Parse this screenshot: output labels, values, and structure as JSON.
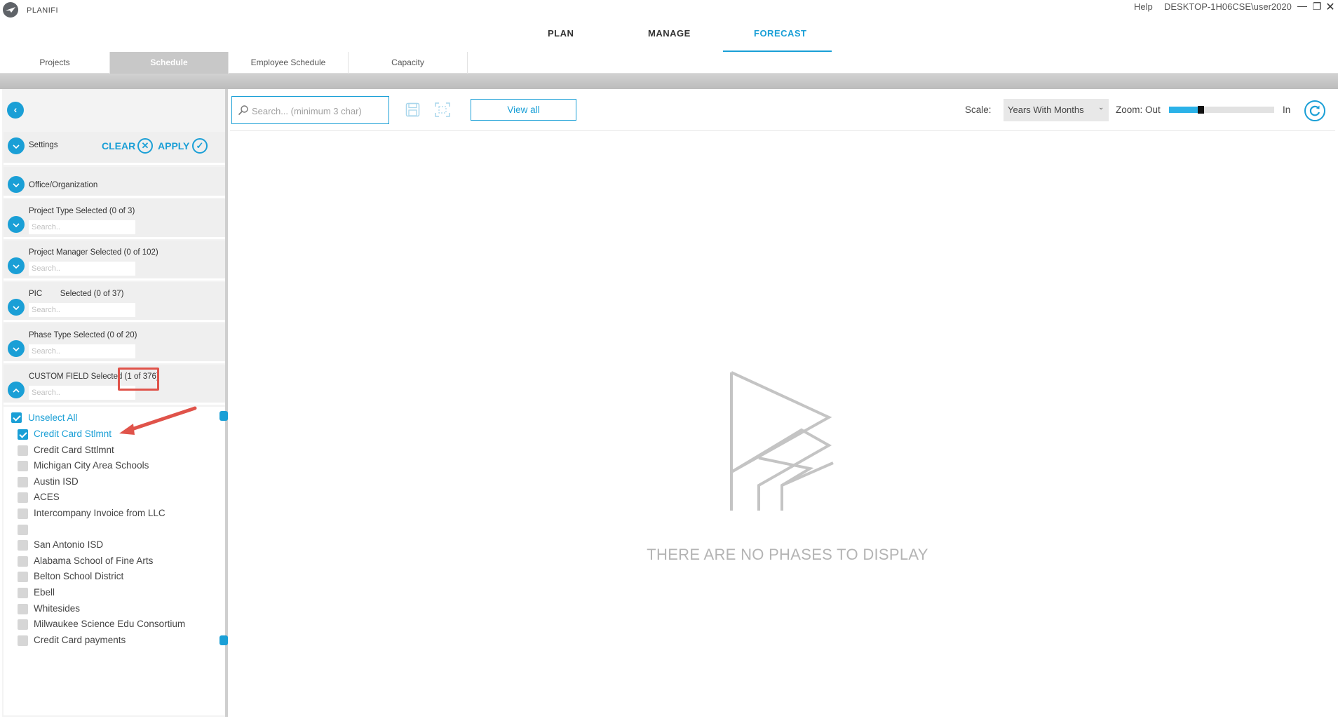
{
  "app": {
    "name": "PLANIFI",
    "help": "Help",
    "user": "DESKTOP-1H06CSE\\user2020"
  },
  "nav": {
    "items": [
      {
        "label": "PLAN"
      },
      {
        "label": "MANAGE"
      },
      {
        "label": "FORECAST",
        "active": true
      }
    ]
  },
  "subtabs": [
    {
      "label": "Projects"
    },
    {
      "label": "Schedule",
      "active": true
    },
    {
      "label": "Employee Schedule"
    },
    {
      "label": "Capacity"
    }
  ],
  "sidebar": {
    "settings_label": "Settings",
    "clear_label": "CLEAR",
    "apply_label": "APPLY",
    "office_label": "Office/Organization",
    "filters": [
      {
        "label": "Project Type  Selected (0 of 3)",
        "placeholder": "Search.."
      },
      {
        "label": "Project Manager Selected (0 of 102)",
        "placeholder": "Search.."
      },
      {
        "label": "PIC        Selected (0 of 37)",
        "placeholder": "Search.."
      },
      {
        "label": "Phase Type  Selected (0 of 20)",
        "placeholder": "Search.."
      },
      {
        "label": "CUSTOM FIELD Selected (1 of 376)",
        "placeholder": "Search.."
      }
    ],
    "unselect_all": "Unselect All",
    "options": [
      {
        "label": "Credit Card Stlmnt",
        "checked": true
      },
      {
        "label": "Credit Card Sttlmnt",
        "checked": false
      },
      {
        "label": "Michigan City Area Schools",
        "checked": false
      },
      {
        "label": "Austin ISD",
        "checked": false
      },
      {
        "label": "ACES",
        "checked": false
      },
      {
        "label": "Intercompany Invoice from LLC",
        "checked": false
      },
      {
        "label": "",
        "checked": false
      },
      {
        "label": "San Antonio ISD",
        "checked": false
      },
      {
        "label": "Alabama School of Fine Arts",
        "checked": false
      },
      {
        "label": "Belton School District",
        "checked": false
      },
      {
        "label": "Ebell",
        "checked": false
      },
      {
        "label": "Whitesides",
        "checked": false
      },
      {
        "label": "Milwaukee Science Edu Consortium",
        "checked": false
      },
      {
        "label": "Credit Card payments",
        "checked": false
      }
    ]
  },
  "toolbar": {
    "search_placeholder": "Search... (minimum 3 char)",
    "view_all": "View all",
    "scale_label": "Scale:",
    "scale_value": "Years With Months",
    "zoom_out_label": "Zoom: Out",
    "zoom_in_label": "In",
    "zoom_level": 0.27
  },
  "main": {
    "empty_message": "THERE ARE NO PHASES TO DISPLAY"
  },
  "colors": {
    "accent": "#1a9fd6",
    "annotation": "#e0534a"
  }
}
